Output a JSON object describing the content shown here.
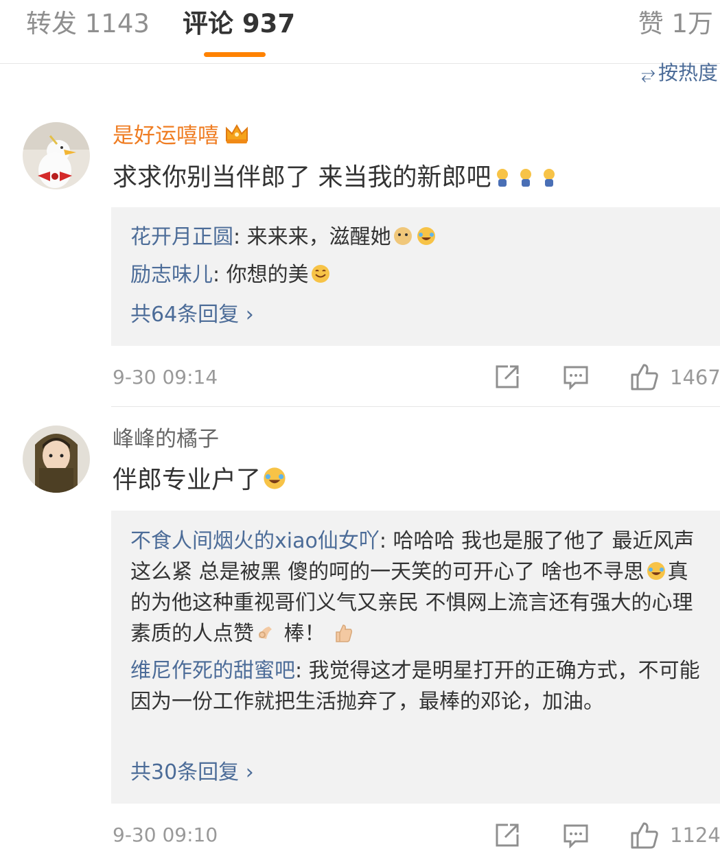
{
  "tabs": {
    "repost": "转发 1143",
    "comment": "评论 937",
    "like": "赞 1万"
  },
  "sort": {
    "icon": "sort-icon",
    "label": "按热度"
  },
  "comments": [
    {
      "username": "是好运嘻嘻",
      "text": "求求你别当伴郎了 来当我的新郎吧",
      "replies": [
        {
          "user": "花开月正圆",
          "text": ": 来来来，滋醒她"
        },
        {
          "user": "励志味儿",
          "text": ": 你想的美"
        }
      ],
      "more_replies": "共64条回复 ›",
      "time": "9-30 09:14",
      "likes": "1467"
    },
    {
      "username": "峰峰的橘子",
      "text": "伴郎专业户了",
      "replies": [
        {
          "user": "不食人间烟火的xiao仙女吖",
          "text": ": 哈哈哈 我也是服了他了 最近风声这么紧 总是被黑 傻的呵的一天笑的可开心了 啥也不寻思",
          "text2": "真的为他这种重视哥们义气又亲民 不惧网上流言还有强大的心理素质的人点赞",
          "text3": " 棒！"
        },
        {
          "user": "维尼作死的甜蜜吧",
          "text": ": 我觉得这才是明星打开的正确方式，不可能因为一份工作就把生活抛弃了，最棒的邓论，加油。"
        }
      ],
      "more_replies": "共30条回复 ›",
      "time": "9-30 09:10",
      "likes": "1124"
    }
  ],
  "colors": {
    "accent": "#ff8200",
    "link": "#4c6c98",
    "vip_name": "#ef7d23"
  }
}
